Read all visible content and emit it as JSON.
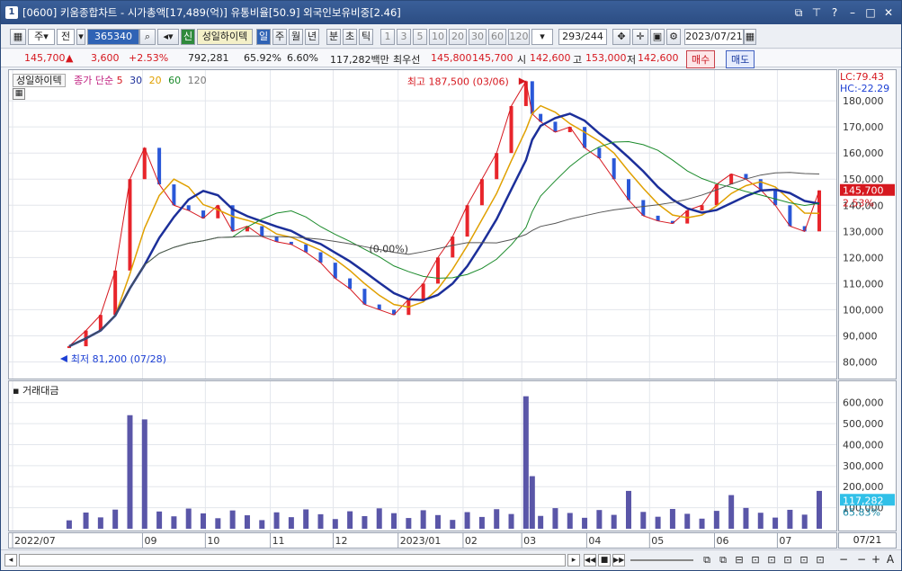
{
  "window": {
    "number": "1",
    "title": "[0600] 키움종합차트 - 시가총액[17,489(억)] 유통비율[50.9] 외국인보유비중[2.46]",
    "controls": [
      "min-restore",
      "maximize",
      "close"
    ]
  },
  "toolbar": {
    "period_type": "주",
    "prev_label": "전",
    "stock_code": "365340",
    "stock_badge": "신",
    "stock_name": "성일하이텍",
    "intervals": [
      "일",
      "주",
      "월",
      "년",
      "분",
      "초",
      "틱"
    ],
    "selected_interval": "일",
    "minute_steps": [
      "1",
      "3",
      "5",
      "10",
      "20",
      "30",
      "60",
      "120"
    ],
    "count_display": "293",
    "count_total": "/244",
    "date_value": "2023/07/21"
  },
  "quote": {
    "price": "145,700",
    "change_arrow": "▲",
    "change": "3,600",
    "change_pct": "+2.53%",
    "volume": "792,281",
    "ratio1": "65.92%",
    "ratio2": "6.60%",
    "trade_value": "117,282백만",
    "best_label": "최우선",
    "best_ask": "145,800",
    "best_bid": "145,700",
    "open_label": "시",
    "open": "142,600",
    "high_label": "고",
    "high": "153,000",
    "low_label": "저",
    "low": "142,600",
    "buy_label": "매수",
    "sell_label": "매도"
  },
  "price_pane": {
    "stock_name": "성일하이텍",
    "ma_label": "종가 단순",
    "ma_periods": [
      "5",
      "30",
      "20",
      "60",
      "120"
    ],
    "ma_colors": [
      "#d6181f",
      "#1c2f9a",
      "#e0a000",
      "#1a8a2a",
      "#555555"
    ],
    "lc_label": "LC:79.43",
    "hc_label": "HC:-22.29",
    "high_annotation": "최고 187,500 (03/06)",
    "low_annotation": "최저 81,200 (07/28)",
    "mid_annotation": "(0.00%)",
    "current_price_tag": "145,700",
    "current_pct_tag": "2.53%"
  },
  "volume_pane": {
    "title": "거래대금",
    "last_value_tag": "117,282",
    "last_pct_tag": "65.83%"
  },
  "date_axis": {
    "ticks": [
      "2022/07",
      "09",
      "10",
      "11",
      "12",
      "2023/01",
      "02",
      "03",
      "04",
      "05",
      "06",
      "07"
    ],
    "right_label": "07/21"
  },
  "chart_data": {
    "type": "line",
    "series": [
      {
        "name": "종가",
        "x": [
          "2022/07/28",
          "2022/08/05",
          "2022/08/12",
          "2022/08/19",
          "2022/08/26",
          "2022/09/02",
          "2022/09/09",
          "2022/09/16",
          "2022/09/23",
          "2022/09/30",
          "2022/10/07",
          "2022/10/14",
          "2022/10/21",
          "2022/10/28",
          "2022/11/04",
          "2022/11/11",
          "2022/11/18",
          "2022/11/25",
          "2022/12/02",
          "2022/12/09",
          "2022/12/16",
          "2022/12/23",
          "2022/12/30",
          "2023/01/06",
          "2023/01/13",
          "2023/01/20",
          "2023/01/27",
          "2023/02/03",
          "2023/02/10",
          "2023/02/17",
          "2023/02/24",
          "2023/03/03",
          "2023/03/06",
          "2023/03/10",
          "2023/03/17",
          "2023/03/24",
          "2023/03/31",
          "2023/04/07",
          "2023/04/14",
          "2023/04/21",
          "2023/04/28",
          "2023/05/05",
          "2023/05/12",
          "2023/05/19",
          "2023/05/26",
          "2023/06/02",
          "2023/06/09",
          "2023/06/16",
          "2023/06/23",
          "2023/06/30",
          "2023/07/07",
          "2023/07/14",
          "2023/07/21"
        ],
        "values": [
          86000,
          92000,
          98000,
          115000,
          150000,
          162000,
          148000,
          140000,
          138000,
          135000,
          140000,
          130000,
          132000,
          128000,
          126000,
          125000,
          122000,
          118000,
          112000,
          108000,
          102000,
          100000,
          98000,
          104000,
          110000,
          120000,
          128000,
          140000,
          150000,
          160000,
          178000,
          187500,
          175000,
          172000,
          168000,
          170000,
          162000,
          158000,
          150000,
          142000,
          136000,
          134000,
          133000,
          138000,
          140000,
          148000,
          152000,
          150000,
          146000,
          140000,
          132000,
          130000,
          145700
        ]
      }
    ],
    "yticks": [
      "180,000",
      "170,000",
      "160,000",
      "150,000",
      "140,000",
      "130,000",
      "120,000",
      "110,000",
      "100,000",
      "90,000",
      "80,000"
    ],
    "ylim": [
      75000,
      189000
    ],
    "volume_yticks": [
      "600,000",
      "500,000",
      "400,000",
      "300,000",
      "200,000",
      "100,000"
    ],
    "volume_ylim": [
      0,
      650000
    ],
    "volume_highlights": {
      "2022/08/26": 540000,
      "2022/09/02": 520000,
      "2023/03/03": 630000,
      "2023/03/06": 250000,
      "2023/04/21": 180000,
      "2023/06/09": 160000,
      "2023/07/21": 180000
    }
  }
}
